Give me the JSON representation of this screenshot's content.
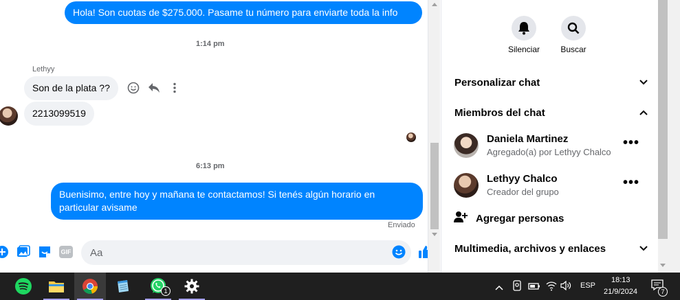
{
  "chat": {
    "messages": {
      "top_out": "Hola! Son cuotas de $275.000. Pasame tu número para enviarte toda la info",
      "time1": "1:14 pm",
      "sender": "Lethyy",
      "in1": "Son de la plata ??",
      "in2": "2213099519",
      "time2": "6:13 pm",
      "out2": "Buenisimo, entre hoy y mañana te contactamos! Si tenés algún horario en particular avisame",
      "status": "Enviado"
    },
    "hover_actions": [
      "emoji-react-icon",
      "reply-icon",
      "more-vertical-icon"
    ],
    "composer": {
      "placeholder": "Aa",
      "icons": [
        "plus-icon",
        "image-icon",
        "sticker-icon",
        "gif-icon",
        "emoji-icon",
        "like-icon"
      ],
      "gif_label": "GIF"
    }
  },
  "panel": {
    "actions": [
      {
        "label": "Silenciar",
        "icon": "bell-icon"
      },
      {
        "label": "Buscar",
        "icon": "search-icon"
      }
    ],
    "sections": {
      "customize": "Personalizar chat",
      "members": "Miembros del chat",
      "media": "Multimedia, archivos y enlaces"
    },
    "members": [
      {
        "name": "Daniela Martinez",
        "role": "Agregado(a) por Lethyy Chalco"
      },
      {
        "name": "Lethyy Chalco",
        "role": "Creador del grupo"
      }
    ],
    "add_people": "Agregar personas"
  },
  "taskbar": {
    "apps": [
      "spotify-icon",
      "file-explorer-icon",
      "chrome-icon",
      "notepad-icon",
      "whatsapp-icon",
      "settings-icon"
    ],
    "whatsapp_badge": "1",
    "lang": "ESP",
    "time": "18:13",
    "date": "21/9/2024",
    "notif_badge": "7"
  },
  "colors": {
    "accent": "#0084ff",
    "bubble_in": "#f0f2f5",
    "taskbar": "#1f1f1f"
  }
}
